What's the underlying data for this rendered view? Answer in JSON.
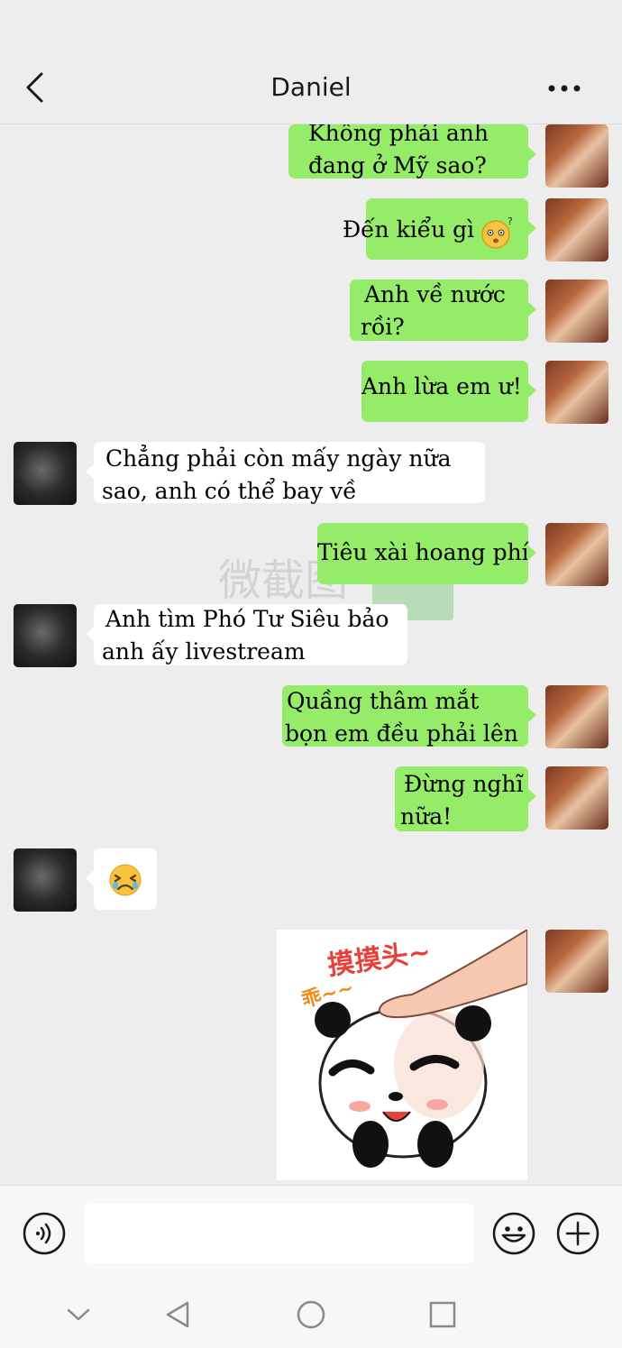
{
  "header": {
    "title": "Daniel",
    "back_icon": "chevron-left-icon",
    "more_icon": "more-dots-icon"
  },
  "messages": [
    {
      "sender": "me",
      "lines": [
        "Không phải anh",
        "đang ở Mỹ sao?"
      ]
    },
    {
      "sender": "me",
      "text": "Đến kiểu gì",
      "emoji": "confused-face-emoji"
    },
    {
      "sender": "me",
      "lines": [
        "Anh về nước",
        "rồi?"
      ]
    },
    {
      "sender": "me",
      "text": "Anh lừa em ư!"
    },
    {
      "sender": "them",
      "lines": [
        "Chẳng phải còn mấy ngày nữa",
        "sao, anh có thể bay về"
      ]
    },
    {
      "sender": "me",
      "text": "Tiêu xài hoang phí"
    },
    {
      "sender": "them",
      "lines": [
        "Anh tìm Phó Tư Siêu bảo",
        "anh ấy livestream"
      ]
    },
    {
      "sender": "me",
      "lines": [
        "Quầng thâm mắt",
        "bọn em đều phải lên"
      ]
    },
    {
      "sender": "me",
      "lines": [
        "Đừng nghĩ",
        "nữa!"
      ]
    },
    {
      "sender": "them",
      "emoji": "crying-face-emoji"
    },
    {
      "sender": "me",
      "sticker": "panda-head-pat-sticker",
      "sticker_text_top": "摸摸头~",
      "sticker_text_side": "乖~~"
    }
  ],
  "watermark": {
    "text": "微截图"
  },
  "input_bar": {
    "voice_icon": "voice-icon",
    "input_placeholder": "",
    "emoji_icon": "emoji-icon",
    "plus_icon": "plus-circle-icon"
  },
  "nav_bar": {
    "items": [
      "chevron-down-icon",
      "back-triangle-icon",
      "home-circle-icon",
      "recents-square-icon"
    ]
  },
  "colors": {
    "my_bubble": "#95ec69",
    "their_bubble": "#ffffff",
    "background": "#ededed"
  }
}
